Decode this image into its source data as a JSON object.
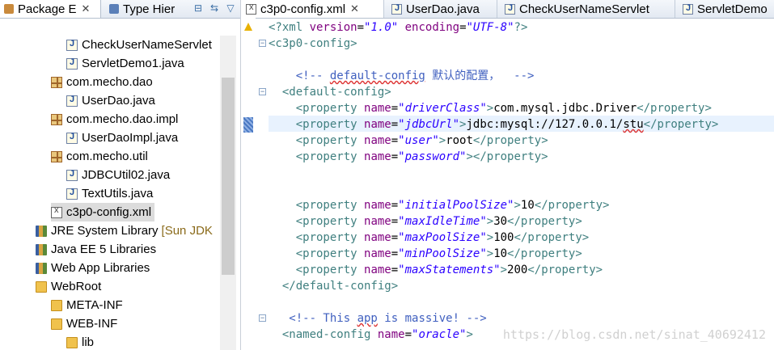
{
  "left_panel": {
    "tabs": [
      {
        "label": "Package E",
        "close": "✕",
        "icon": "package-explorer-icon",
        "active": true
      },
      {
        "label": "Type Hier",
        "icon": "type-hierarchy-icon",
        "active": false
      }
    ],
    "tools": [
      "collapse-all-icon",
      "link-editor-icon",
      "view-menu-icon"
    ],
    "tree": [
      {
        "label": "CheckUserNameServlet",
        "icon": "java-file-icon",
        "indent": 3
      },
      {
        "label": "ServletDemo1.java",
        "icon": "java-file-icon",
        "indent": 3
      },
      {
        "label": "com.mecho.dao",
        "icon": "package-icon",
        "indent": 2
      },
      {
        "label": "UserDao.java",
        "icon": "java-file-icon",
        "indent": 3
      },
      {
        "label": "com.mecho.dao.impl",
        "icon": "package-icon",
        "indent": 2
      },
      {
        "label": "UserDaoImpl.java",
        "icon": "java-file-icon",
        "indent": 3
      },
      {
        "label": "com.mecho.util",
        "icon": "package-icon",
        "indent": 2
      },
      {
        "label": "JDBCUtil02.java",
        "icon": "java-file-icon",
        "indent": 3
      },
      {
        "label": "TextUtils.java",
        "icon": "java-file-icon",
        "indent": 3
      },
      {
        "label": "c3p0-config.xml",
        "icon": "xml-file-icon",
        "indent": 2,
        "selected": true
      },
      {
        "label": "JRE System Library",
        "sub": "[Sun JDK",
        "icon": "library-icon",
        "indent": 1
      },
      {
        "label": "Java EE 5 Libraries",
        "icon": "library-icon",
        "indent": 1
      },
      {
        "label": "Web App Libraries",
        "icon": "library-icon",
        "indent": 1
      },
      {
        "label": "WebRoot",
        "icon": "folder-icon",
        "indent": 1
      },
      {
        "label": "META-INF",
        "icon": "folder-icon",
        "indent": 2
      },
      {
        "label": "WEB-INF",
        "icon": "folder-icon",
        "indent": 2
      },
      {
        "label": "lib",
        "icon": "folder-icon",
        "indent": 3
      }
    ]
  },
  "editor": {
    "tabs": [
      {
        "label": "c3p0-config.xml",
        "close": "✕",
        "icon": "xml-file-icon",
        "active": true
      },
      {
        "label": "UserDao.java",
        "icon": "java-file-icon",
        "active": false
      },
      {
        "label": "CheckUserNameServlet",
        "icon": "java-file-icon",
        "active": false
      },
      {
        "label": "ServletDemo",
        "icon": "java-file-icon",
        "active": false
      }
    ],
    "lines": [
      {
        "parts": [
          [
            "t",
            "<?xml "
          ],
          [
            "a",
            "version"
          ],
          [
            "",
            "="
          ],
          [
            "s",
            "\"1.0\""
          ],
          [
            "",
            " "
          ],
          [
            "a",
            "encoding"
          ],
          [
            "",
            "="
          ],
          [
            "s",
            "\"UTF-8\""
          ],
          [
            "t",
            "?>"
          ]
        ]
      },
      {
        "parts": [
          [
            "t",
            "<c3p0-config>"
          ]
        ]
      },
      {
        "parts": []
      },
      {
        "parts": [
          [
            "c",
            "    <!-- "
          ],
          [
            "csq",
            "default-config"
          ],
          [
            "c",
            " 默认的配置，  -->"
          ]
        ]
      },
      {
        "parts": [
          [
            "t",
            "  <default-config>"
          ]
        ]
      },
      {
        "parts": [
          [
            "t",
            "    <property "
          ],
          [
            "a",
            "name"
          ],
          [
            "",
            "="
          ],
          [
            "s",
            "\"driverClass\""
          ],
          [
            "t",
            ">"
          ],
          [
            "",
            "com.mysql.jdbc.Driver"
          ],
          [
            "t",
            "</property>"
          ]
        ]
      },
      {
        "parts": [
          [
            "t",
            "    <property "
          ],
          [
            "a",
            "name"
          ],
          [
            "",
            "="
          ],
          [
            "s",
            "\"jdbcUrl\""
          ],
          [
            "t",
            ">"
          ],
          [
            "",
            "jdbc:mysql://127.0.0.1/"
          ],
          [
            "sq",
            "stu"
          ],
          [
            "t",
            "</property>"
          ]
        ]
      },
      {
        "parts": [
          [
            "t",
            "    <property "
          ],
          [
            "a",
            "name"
          ],
          [
            "",
            "="
          ],
          [
            "s",
            "\"user\""
          ],
          [
            "t",
            ">"
          ],
          [
            "",
            "root"
          ],
          [
            "t",
            "</property>"
          ]
        ]
      },
      {
        "parts": [
          [
            "t",
            "    <property "
          ],
          [
            "a",
            "name"
          ],
          [
            "",
            "="
          ],
          [
            "s",
            "\"password\""
          ],
          [
            "t",
            "></property>"
          ]
        ]
      },
      {
        "parts": []
      },
      {
        "parts": []
      },
      {
        "parts": [
          [
            "t",
            "    <property "
          ],
          [
            "a",
            "name"
          ],
          [
            "",
            "="
          ],
          [
            "s",
            "\"initialPoolSize\""
          ],
          [
            "t",
            ">"
          ],
          [
            "",
            "10"
          ],
          [
            "t",
            "</property>"
          ]
        ]
      },
      {
        "parts": [
          [
            "t",
            "    <property "
          ],
          [
            "a",
            "name"
          ],
          [
            "",
            "="
          ],
          [
            "s",
            "\"maxIdleTime\""
          ],
          [
            "t",
            ">"
          ],
          [
            "",
            "30"
          ],
          [
            "t",
            "</property>"
          ]
        ]
      },
      {
        "parts": [
          [
            "t",
            "    <property "
          ],
          [
            "a",
            "name"
          ],
          [
            "",
            "="
          ],
          [
            "s",
            "\"maxPoolSize\""
          ],
          [
            "t",
            ">"
          ],
          [
            "",
            "100"
          ],
          [
            "t",
            "</property>"
          ]
        ]
      },
      {
        "parts": [
          [
            "t",
            "    <property "
          ],
          [
            "a",
            "name"
          ],
          [
            "",
            "="
          ],
          [
            "s",
            "\"minPoolSize\""
          ],
          [
            "t",
            ">"
          ],
          [
            "",
            "10"
          ],
          [
            "t",
            "</property>"
          ]
        ]
      },
      {
        "parts": [
          [
            "t",
            "    <property "
          ],
          [
            "a",
            "name"
          ],
          [
            "",
            "="
          ],
          [
            "s",
            "\"maxStatements\""
          ],
          [
            "t",
            ">"
          ],
          [
            "",
            "200"
          ],
          [
            "t",
            "</property>"
          ]
        ]
      },
      {
        "parts": [
          [
            "t",
            "  </default-config>"
          ]
        ]
      },
      {
        "parts": []
      },
      {
        "parts": [
          [
            "c",
            "   <!-- This "
          ],
          [
            "csq",
            "app"
          ],
          [
            "c",
            " is massive! -->"
          ]
        ]
      },
      {
        "parts": [
          [
            "t",
            "  <named-config "
          ],
          [
            "a",
            "name"
          ],
          [
            "",
            "="
          ],
          [
            "s",
            "\"oracle\""
          ],
          [
            "t",
            ">"
          ]
        ]
      }
    ],
    "fold_lines": [
      1,
      4,
      18
    ],
    "highlight_line": 6,
    "watermark": "https://blog.csdn.net/sinat_40692412"
  }
}
